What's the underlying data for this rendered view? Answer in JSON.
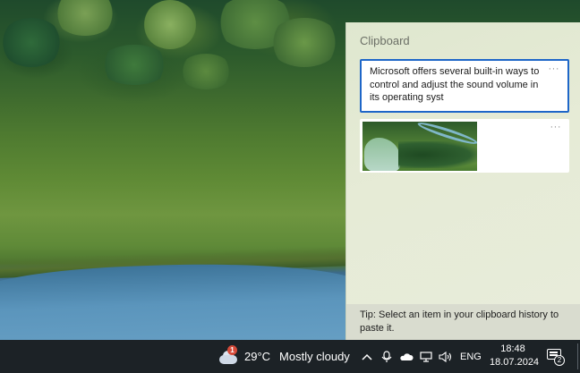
{
  "clipboard": {
    "title": "Clipboard",
    "items": [
      {
        "type": "text",
        "text": "Microsoft offers several built-in ways to control and adjust the sound volume in its operating syst",
        "more_label": "···",
        "selected": true
      },
      {
        "type": "image",
        "more_label": "···",
        "selected": false
      }
    ],
    "tip": "Tip: Select an item in your clipboard history to paste it."
  },
  "taskbar": {
    "weather": {
      "badge": "1",
      "temperature": "29°C",
      "condition": "Mostly cloudy"
    },
    "tray": {
      "language": "ENG"
    },
    "clock": {
      "time": "18:48",
      "date": "18.07.2024"
    },
    "notifications": {
      "count": "2"
    }
  },
  "colors": {
    "accent": "#1e66c8",
    "taskbar": "#1c2226",
    "badge": "#d64b3a"
  }
}
